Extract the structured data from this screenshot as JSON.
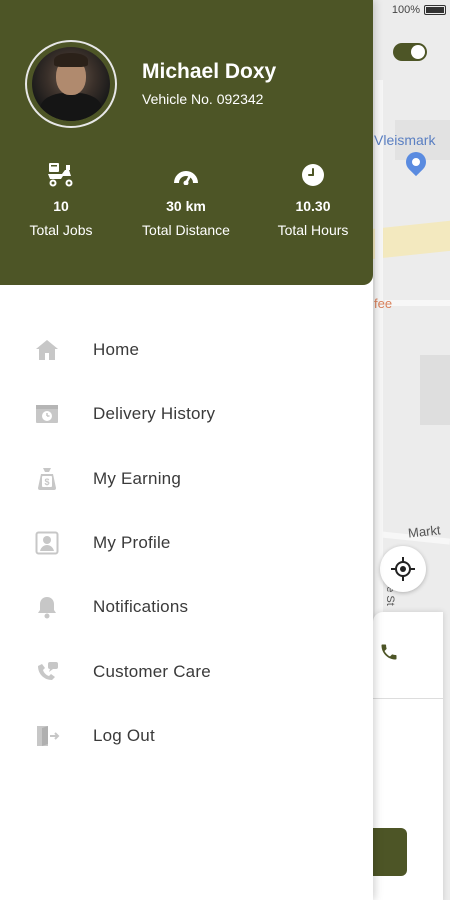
{
  "status_bar": {
    "battery": "100%"
  },
  "map": {
    "place_label": "Vleismark",
    "cafe_label": "fee",
    "street_label": "Markt",
    "street_label2": "e St"
  },
  "driver": {
    "name": "Michael Doxy",
    "vehicle": "Vehicle No. 092342"
  },
  "stats": [
    {
      "icon": "delivery-scooter-icon",
      "value": "10",
      "caption": "Total Jobs"
    },
    {
      "icon": "speedometer-icon",
      "value": "30 km",
      "caption": "Total Distance"
    },
    {
      "icon": "clock-icon",
      "value": "10.30",
      "caption": "Total Hours"
    }
  ],
  "menu": [
    {
      "icon": "home-icon",
      "label": "Home"
    },
    {
      "icon": "delivery-history-icon",
      "label": "Delivery History"
    },
    {
      "icon": "money-bag-icon",
      "label": "My Earning"
    },
    {
      "icon": "profile-card-icon",
      "label": "My Profile"
    },
    {
      "icon": "bell-icon",
      "label": "Notifications"
    },
    {
      "icon": "customer-care-icon",
      "label": "Customer Care"
    },
    {
      "icon": "logout-icon",
      "label": "Log Out"
    }
  ],
  "colors": {
    "brand": "#4d5526",
    "menu_icon": "#c7c7c7",
    "menu_text": "#3a3a3a"
  }
}
